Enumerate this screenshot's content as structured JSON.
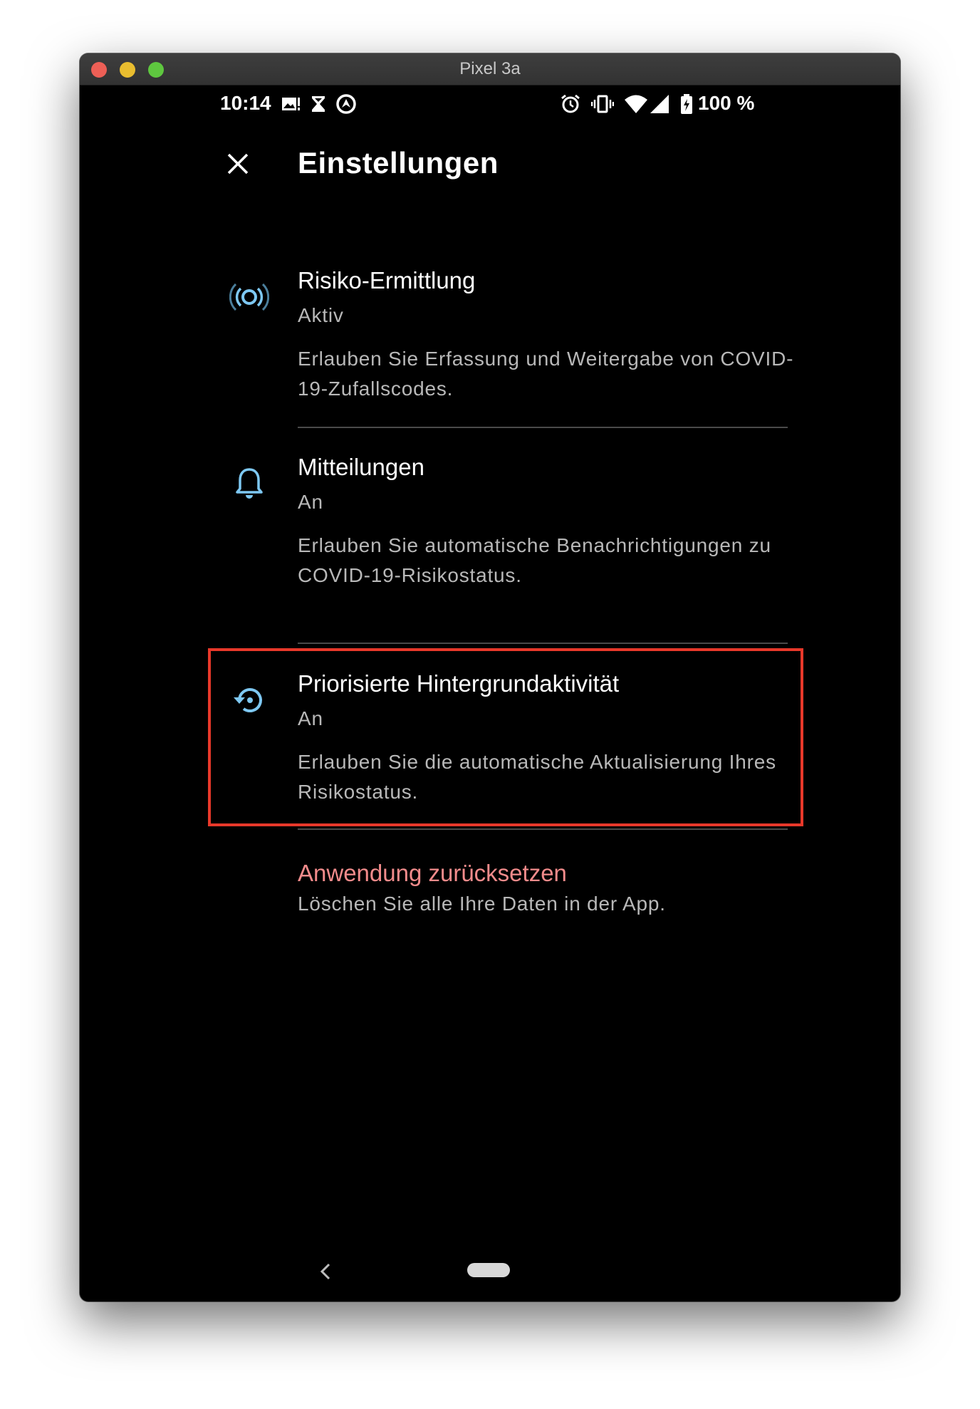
{
  "window": {
    "title": "Pixel 3a"
  },
  "status_bar": {
    "time": "10:14",
    "battery": "100 %",
    "left_icons": [
      "image-notification-icon",
      "hourglass-icon",
      "location-sync-icon"
    ],
    "right_icons": [
      "alarm-icon",
      "vibrate-icon",
      "wifi-icon",
      "cell-signal-icon",
      "battery-icon"
    ]
  },
  "header": {
    "close_icon": "close-icon",
    "title": "Einstellungen"
  },
  "settings": [
    {
      "icon": "exposure-notification-icon",
      "title": "Risiko-Ermittlung",
      "state": "Aktiv",
      "description": "Erlauben Sie Erfassung und Weitergabe von COVID-19-Zufallscodes."
    },
    {
      "icon": "bell-icon",
      "title": "Mitteilungen",
      "state": "An",
      "description": "Erlauben Sie automatische Benachrichtigungen zu COVID-19-Risikostatus."
    },
    {
      "icon": "background-refresh-icon",
      "title": "Priorisierte Hintergrundaktivität",
      "state": "An",
      "description": "Erlauben Sie die automatische Aktualisierung Ihres Risikostatus.",
      "highlighted": true
    }
  ],
  "reset": {
    "title": "Anwendung zurücksetzen",
    "description": "Löschen Sie alle Ihre Daten in der App."
  },
  "colors": {
    "accent": "#7ec8f2",
    "danger": "#f28b8b",
    "highlight_border": "#e8382a",
    "background": "#000000"
  }
}
